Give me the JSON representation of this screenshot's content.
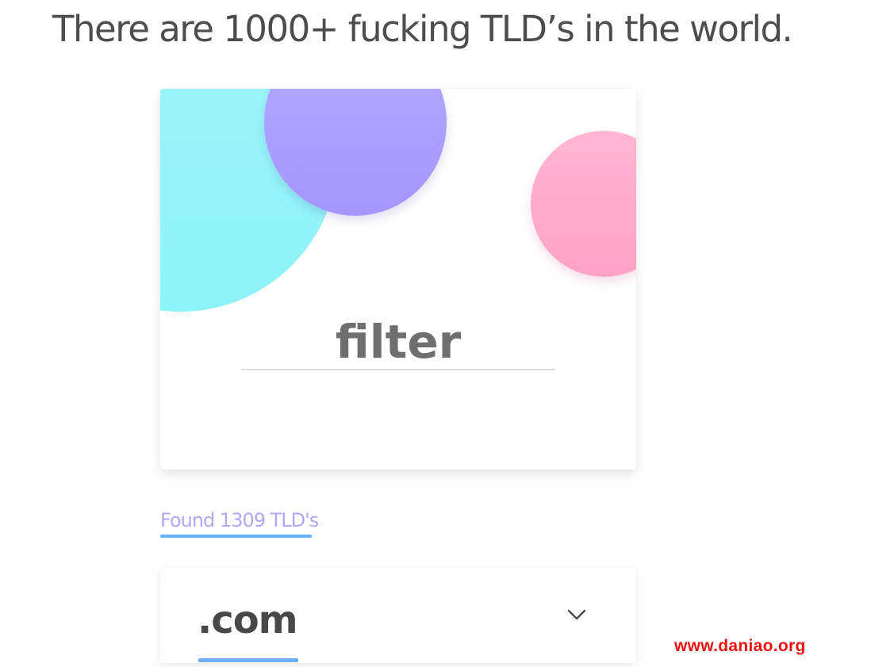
{
  "headline": "There are 1000+ fucking TLD’s in the world.",
  "filter": {
    "placeholder": "filter",
    "bubble_colors": [
      "#8ef3f9",
      "#a596ff",
      "#ffa2c5"
    ]
  },
  "results": {
    "found_text": "Found 1309 TLD's"
  },
  "tld_list": [
    {
      "name": ".com",
      "toggle_icon": "chevron-down-icon"
    }
  ],
  "colors": {
    "accent_blue": "#6ab0f6",
    "accent_purple": "#b5a6f3"
  },
  "watermark": "www.daniao.org"
}
